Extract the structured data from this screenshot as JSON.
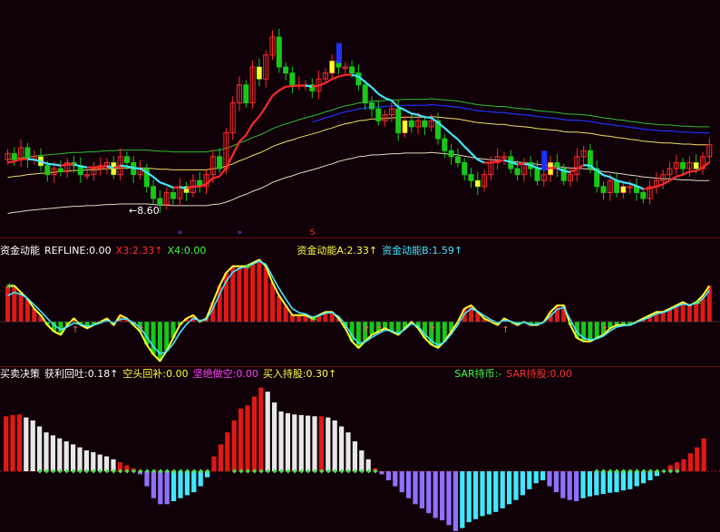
{
  "colors": {
    "background": "#100008",
    "up": "#ff2a2a",
    "down": "#18c818",
    "yellow": "#ffff30",
    "cyan": "#40e8ff",
    "blue": "#2030ff",
    "green_line": "#30c030",
    "purple": "#9070ff",
    "white": "#e8e8e8",
    "magenta": "#ff40ff",
    "divider": "#6a0a0a"
  },
  "price_panel": {
    "low_label": "←8.60",
    "marker_icons": [
      "arrow-marker-icon",
      "arrow-marker-icon",
      "s-marker-icon"
    ]
  },
  "money_panel": {
    "legend": [
      {
        "text": "资金动能",
        "color": "#ffffff"
      },
      {
        "text": "REFLINE:0.00",
        "color": "#ffffff"
      },
      {
        "text": "X3:2.33↑",
        "color": "#ff3030"
      },
      {
        "text": "X4:0.00",
        "color": "#40ff40"
      },
      {
        "text": "资金动能A:2.33↑",
        "color": "#ffff40"
      },
      {
        "text": "资金动能B:1.59↑",
        "color": "#40e8ff"
      }
    ],
    "ylim": [
      -1,
      1
    ]
  },
  "signal_panel": {
    "legend": [
      {
        "text": "买卖决策",
        "color": "#ffffff"
      },
      {
        "text": "获利回吐:0.18↑",
        "color": "#ffffff"
      },
      {
        "text": "空头回补:0.00",
        "color": "#ffff40"
      },
      {
        "text": "坚绝做空:0.00",
        "color": "#ff40ff"
      },
      {
        "text": "买入持股:0.30↑",
        "color": "#ffff40"
      },
      {
        "text": "SAR持币:-",
        "color": "#40ff40"
      },
      {
        "text": "SAR持股:0.00",
        "color": "#ff3030"
      }
    ]
  },
  "chart_data": [
    {
      "type": "candlestick",
      "series": [
        {
          "name": "close",
          "values": [
            9.45,
            9.35,
            9.55,
            9.35,
            9.4,
            9.25,
            9.1,
            9.2,
            9.15,
            9.3,
            9.25,
            9.1,
            9.1,
            9.2,
            9.25,
            9.3,
            9.1,
            9.4,
            9.3,
            9.1,
            9.2,
            8.9,
            8.7,
            8.6,
            8.8,
            8.7,
            8.9,
            8.8,
            9.0,
            8.9,
            9.1,
            9.4,
            9.2,
            9.8,
            10.3,
            10.6,
            10.3,
            10.9,
            10.7,
            11.1,
            11.4,
            10.9,
            10.8,
            10.6,
            10.6,
            10.6,
            10.5,
            10.7,
            10.8,
            11.0,
            10.9,
            10.9,
            10.8,
            10.6,
            10.3,
            10.2,
            10.0,
            10.1,
            10.2,
            9.8,
            10.0,
            9.9,
            10.0,
            9.9,
            10.0,
            9.7,
            9.5,
            9.4,
            9.3,
            9.1,
            9.0,
            8.9,
            9.1,
            9.3,
            9.4,
            9.4,
            9.2,
            9.1,
            9.3,
            9.2,
            9.0,
            9.1,
            9.3,
            9.2,
            9.0,
            9.1,
            9.4,
            9.5,
            9.2,
            8.9,
            8.8,
            9.0,
            8.8,
            8.9,
            8.9,
            8.8,
            8.7,
            8.9,
            9.0,
            9.1,
            9.2,
            9.3,
            9.2,
            9.3,
            9.2,
            9.4,
            9.6
          ]
        },
        {
          "name": "ma_fast",
          "values": [
            9.3,
            9.32,
            9.36,
            9.36,
            9.35,
            9.32,
            9.28,
            9.27,
            9.25,
            9.27,
            9.27,
            9.24,
            9.22,
            9.22,
            9.23,
            9.24,
            9.21,
            9.25,
            9.24,
            9.21,
            9.2,
            9.14,
            9.06,
            8.97,
            8.93,
            8.88,
            8.89,
            8.87,
            8.9,
            8.9,
            8.94,
            9.04,
            9.07,
            9.21,
            9.43,
            9.65,
            9.76,
            9.95,
            10.07,
            10.24,
            10.42,
            10.51,
            10.57,
            10.58,
            10.59,
            10.59,
            10.57,
            10.59,
            10.63,
            10.7,
            10.74,
            10.77,
            10.77,
            10.74,
            10.65,
            10.56,
            10.45,
            10.38,
            10.34,
            10.23,
            10.18,
            10.12,
            10.1,
            10.06,
            10.05,
            9.97,
            9.88,
            9.78,
            9.69,
            9.57,
            9.46,
            9.35,
            9.3,
            9.3,
            9.32,
            9.34,
            9.31,
            9.27,
            9.28,
            9.26,
            9.21,
            9.19,
            9.21,
            9.21,
            9.16,
            9.14,
            9.2,
            9.26,
            9.25,
            9.17,
            9.09,
            9.06,
            9.0,
            8.97,
            8.95,
            8.91,
            8.86,
            8.87,
            8.9,
            8.94,
            9.0,
            9.07,
            9.1,
            9.15,
            9.16,
            9.22,
            9.31
          ]
        },
        {
          "name": "ma_slow",
          "values": [
            8.8,
            8.82,
            8.83,
            8.85,
            8.86,
            8.87,
            8.88,
            8.89,
            8.9,
            8.91,
            8.92,
            8.92,
            8.93,
            8.93,
            8.94,
            8.95,
            8.95,
            8.96,
            8.96,
            8.96,
            8.96,
            8.96,
            8.95,
            8.94,
            8.94,
            8.93,
            8.93,
            8.93,
            8.93,
            8.93,
            8.93,
            8.95,
            8.96,
            8.99,
            9.03,
            9.08,
            9.12,
            9.17,
            9.21,
            9.26,
            9.32,
            9.36,
            9.4,
            9.43,
            9.47,
            9.5,
            9.53,
            9.56,
            9.6,
            9.63,
            9.67,
            9.7,
            9.72,
            9.75,
            9.76,
            9.78,
            9.78,
            9.79,
            9.8,
            9.8,
            9.81,
            9.81,
            9.81,
            9.81,
            9.82,
            9.81,
            9.8,
            9.79,
            9.78,
            9.76,
            9.74,
            9.72,
            9.71,
            9.7,
            9.69,
            9.69,
            9.67,
            9.66,
            9.65,
            9.64,
            9.62,
            9.61,
            9.6,
            9.59,
            9.57,
            9.56,
            9.56,
            9.55,
            9.54,
            9.52,
            9.5,
            9.49,
            9.47,
            9.46,
            9.44,
            9.43,
            9.41,
            9.4,
            9.39,
            9.38,
            9.38,
            9.37,
            9.36,
            9.36,
            9.35,
            9.35,
            9.35
          ]
        }
      ]
    },
    {
      "type": "bar",
      "series": [
        {
          "name": "资金动能A",
          "values": [
            0.55,
            0.55,
            0.45,
            0.35,
            0.2,
            0.1,
            -0.05,
            -0.15,
            -0.2,
            -0.05,
            0.05,
            -0.05,
            -0.1,
            -0.05,
            0.0,
            0.05,
            -0.05,
            0.1,
            0.05,
            -0.05,
            -0.15,
            -0.35,
            -0.5,
            -0.6,
            -0.45,
            -0.25,
            -0.05,
            0.05,
            0.1,
            0.0,
            0.05,
            0.3,
            0.55,
            0.75,
            0.85,
            0.85,
            0.85,
            0.9,
            0.95,
            0.85,
            0.6,
            0.4,
            0.25,
            0.1,
            0.1,
            0.1,
            0.05,
            0.1,
            0.15,
            0.15,
            0.05,
            -0.1,
            -0.3,
            -0.4,
            -0.3,
            -0.2,
            -0.15,
            -0.1,
            -0.15,
            -0.2,
            -0.1,
            0.0,
            -0.1,
            -0.25,
            -0.35,
            -0.4,
            -0.3,
            -0.15,
            0.0,
            0.2,
            0.25,
            0.15,
            0.05,
            0.0,
            -0.05,
            0.05,
            0.0,
            -0.05,
            0.0,
            -0.05,
            -0.05,
            0.0,
            0.15,
            0.25,
            0.25,
            -0.05,
            -0.25,
            -0.3,
            -0.3,
            -0.25,
            -0.2,
            -0.1,
            -0.05,
            -0.05,
            -0.05,
            0.0,
            0.05,
            0.1,
            0.15,
            0.15,
            0.2,
            0.25,
            0.3,
            0.25,
            0.3,
            0.4,
            0.55
          ]
        },
        {
          "name": "资金动能B",
          "values": [
            0.4,
            0.45,
            0.42,
            0.36,
            0.26,
            0.16,
            0.05,
            -0.05,
            -0.12,
            -0.08,
            -0.02,
            -0.04,
            -0.07,
            -0.05,
            -0.02,
            0.02,
            -0.02,
            0.04,
            0.04,
            -0.01,
            -0.09,
            -0.23,
            -0.38,
            -0.49,
            -0.46,
            -0.34,
            -0.17,
            -0.04,
            0.05,
            0.02,
            0.03,
            0.2,
            0.42,
            0.62,
            0.76,
            0.82,
            0.84,
            0.88,
            0.93,
            0.88,
            0.69,
            0.51,
            0.35,
            0.2,
            0.14,
            0.12,
            0.07,
            0.09,
            0.13,
            0.14,
            0.08,
            -0.04,
            -0.21,
            -0.33,
            -0.31,
            -0.24,
            -0.18,
            -0.13,
            -0.14,
            -0.18,
            -0.12,
            -0.03,
            -0.07,
            -0.19,
            -0.29,
            -0.36,
            -0.31,
            -0.19,
            -0.05,
            0.12,
            0.2,
            0.16,
            0.09,
            0.03,
            -0.02,
            0.02,
            0.01,
            -0.03,
            -0.01,
            -0.04,
            -0.04,
            -0.01,
            0.09,
            0.19,
            0.22,
            0.03,
            -0.16,
            -0.25,
            -0.28,
            -0.26,
            -0.22,
            -0.14,
            -0.08,
            -0.06,
            -0.05,
            -0.01,
            0.03,
            0.07,
            0.12,
            0.14,
            0.18,
            0.23,
            0.27,
            0.26,
            0.28,
            0.35,
            0.48
          ]
        }
      ]
    },
    {
      "type": "bar",
      "series": [
        {
          "name": "获利回吐",
          "values": [
            0.92,
            0.94,
            0.95,
            0.9,
            0.85,
            0.75,
            0.65,
            0.6,
            0.55,
            0.5,
            0.45,
            0.4,
            0.35,
            0.32,
            0.28,
            0.25,
            0.2,
            0.15,
            0.1,
            0.05,
            -0.05,
            -0.25,
            -0.45,
            -0.55,
            -0.55,
            -0.5,
            -0.45,
            -0.4,
            -0.35,
            -0.25,
            -0.1,
            0.25,
            0.45,
            0.65,
            0.85,
            1.05,
            1.1,
            1.25,
            1.4,
            1.33,
            1.15,
            1.0,
            0.97,
            0.95,
            0.94,
            0.93,
            0.92,
            0.92,
            0.9,
            0.85,
            0.75,
            0.65,
            0.5,
            0.35,
            0.2,
            0.05,
            -0.05,
            -0.15,
            -0.25,
            -0.35,
            -0.45,
            -0.55,
            -0.62,
            -0.7,
            -0.78,
            -0.82,
            -0.9,
            -1.0,
            -0.95,
            -0.85,
            -0.8,
            -0.75,
            -0.72,
            -0.68,
            -0.62,
            -0.55,
            -0.48,
            -0.4,
            -0.3,
            -0.2,
            -0.15,
            -0.25,
            -0.35,
            -0.45,
            -0.48,
            -0.5,
            -0.45,
            -0.42,
            -0.4,
            -0.38,
            -0.36,
            -0.35,
            -0.32,
            -0.3,
            -0.25,
            -0.2,
            -0.15,
            -0.08,
            0.0,
            0.1,
            0.15,
            0.2,
            0.3,
            0.4,
            0.55
          ]
        }
      ]
    }
  ]
}
